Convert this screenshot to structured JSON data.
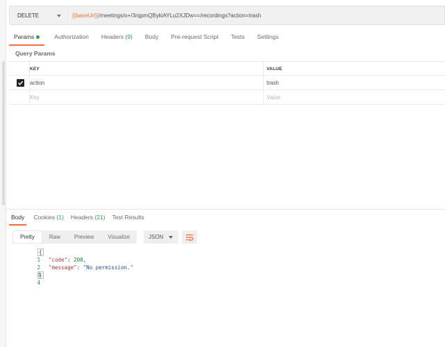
{
  "request": {
    "method": "DELETE",
    "url_var": "{{baseUrl}}",
    "url_rest": "/meetings/o+/3rqpmQBykiAYLu2XJDw==/recordings?action=trash"
  },
  "request_tabs": {
    "params": "Params",
    "authorization": "Authorization",
    "headers": "Headers",
    "headers_count": "(9)",
    "body": "Body",
    "prerequest": "Pre-request Script",
    "tests": "Tests",
    "settings": "Settings"
  },
  "query_params": {
    "title": "Query Params",
    "header_key": "KEY",
    "header_value": "VALUE",
    "rows": [
      {
        "key": "action",
        "value": "trash",
        "checked": true
      }
    ],
    "placeholder_key": "Key",
    "placeholder_value": "Value"
  },
  "response_tabs": {
    "body": "Body",
    "cookies": "Cookies",
    "cookies_count": "(1)",
    "headers": "Headers",
    "headers_count": "(21)",
    "test_results": "Test Results"
  },
  "view_modes": {
    "pretty": "Pretty",
    "raw": "Raw",
    "preview": "Preview",
    "visualize": "Visualize",
    "active": "Pretty"
  },
  "format": "JSON",
  "response_body": {
    "line_numbers": [
      "1",
      "2",
      "3",
      "4"
    ],
    "open_brace": "{",
    "close_brace": "}",
    "code_key": "\"code\"",
    "code_value": "200",
    "message_key": "\"message\"",
    "message_value": "\"No permission.\""
  },
  "colors": {
    "accent": "#f26b3a",
    "count_green": "#2f9c4a",
    "url_variable": "#e8743b"
  }
}
